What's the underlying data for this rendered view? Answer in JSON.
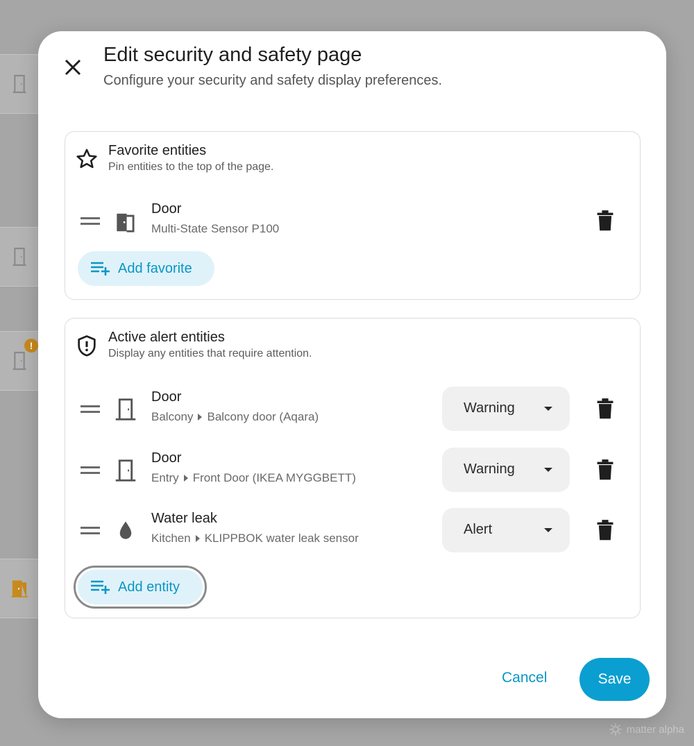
{
  "dialog": {
    "title": "Edit security and safety page",
    "subtitle": "Configure your security and safety display preferences."
  },
  "favorites": {
    "title": "Favorite entities",
    "subtitle": "Pin entities to the top of the page.",
    "items": [
      {
        "name": "Door",
        "device": "Multi-State Sensor P100",
        "icon": "door-icon"
      }
    ],
    "add_label": "Add favorite"
  },
  "alerts": {
    "title": "Active alert entities",
    "subtitle": "Display any entities that require attention.",
    "items": [
      {
        "name": "Door",
        "area": "Balcony",
        "device": "Balcony door (Aqara)",
        "level": "Warning",
        "icon": "door-icon"
      },
      {
        "name": "Door",
        "area": "Entry",
        "device": "Front Door (IKEA MYGGBETT)",
        "level": "Warning",
        "icon": "door-icon"
      },
      {
        "name": "Water leak",
        "area": "Kitchen",
        "device": "KLIPPBOK water leak sensor",
        "level": "Alert",
        "icon": "water-drop-icon"
      }
    ],
    "add_label": "Add entity"
  },
  "footer": {
    "cancel_label": "Cancel",
    "save_label": "Save"
  },
  "background": {
    "badge": "!"
  },
  "watermark": "matter alpha",
  "colors": {
    "accent": "#0a9fd0",
    "accent_soft": "#dff2fa",
    "backdrop": "#a6a6a6",
    "warning_badge": "#c88a1d"
  }
}
